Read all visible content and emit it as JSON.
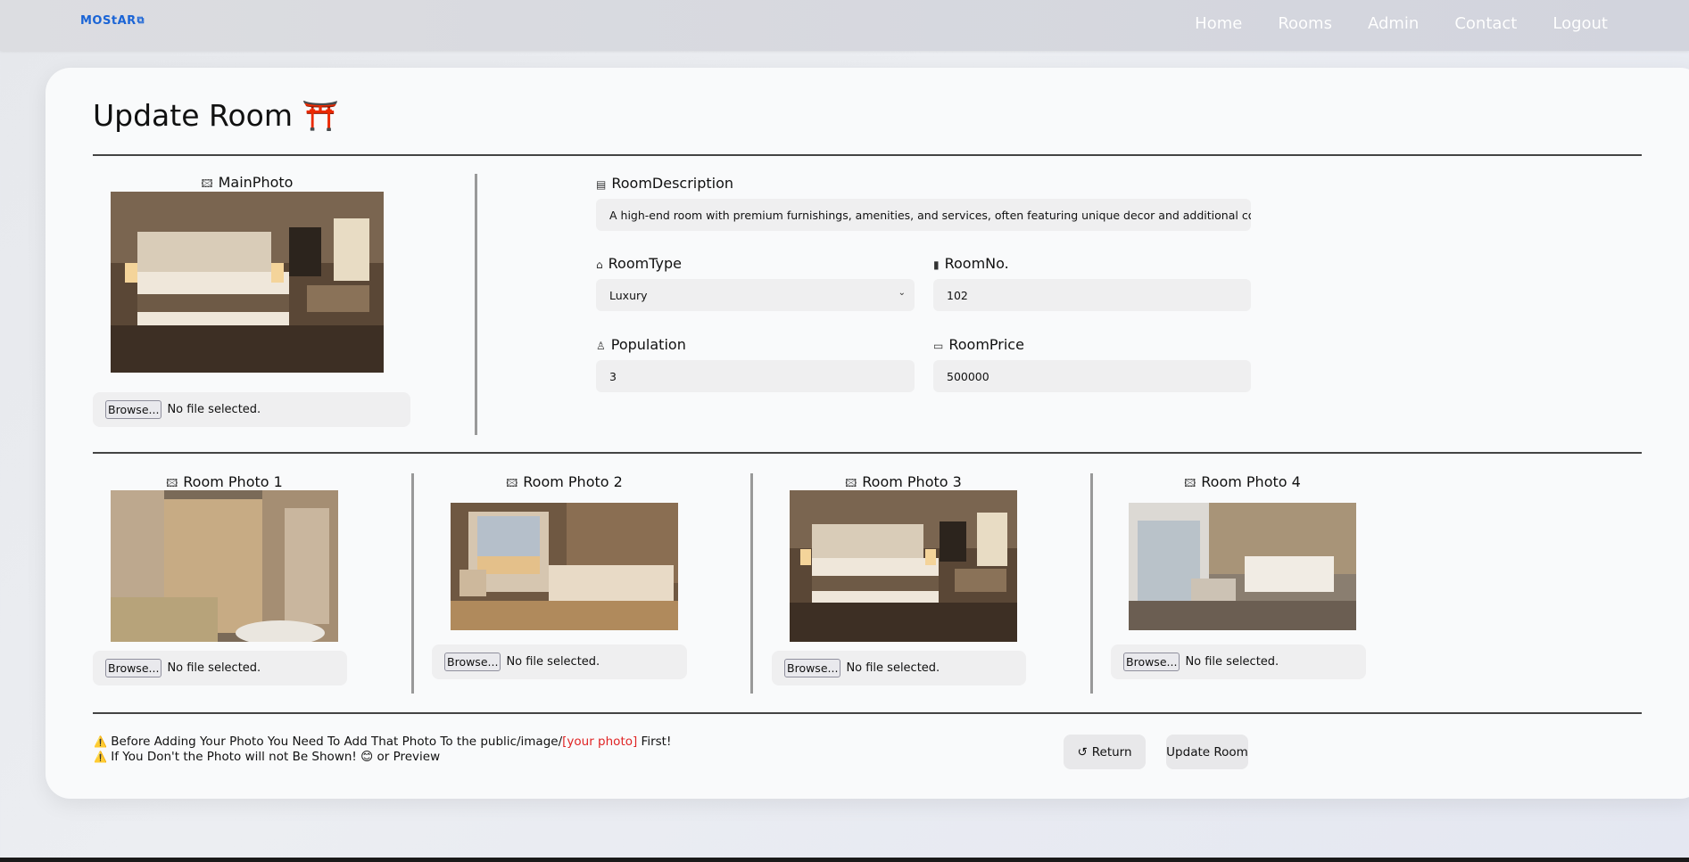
{
  "nav": {
    "brand": "MOStAR",
    "brand_icon": "external-link-icon",
    "links": [
      "Home",
      "Rooms",
      "Admin",
      "Contact",
      "Logout"
    ]
  },
  "page": {
    "title": "Update Room",
    "title_emoji": "⛩️"
  },
  "main_photo": {
    "label": "MainPhoto",
    "browse_label": "Browse...",
    "file_status": "No file selected."
  },
  "form": {
    "description": {
      "label": "RoomDescription",
      "value": "A high-end room with premium furnishings, amenities, and services, often featuring unique decor and additional comforts"
    },
    "room_type": {
      "label": "RoomType",
      "value": "Luxury"
    },
    "room_no": {
      "label": "RoomNo.",
      "value": "102"
    },
    "population": {
      "label": "Population",
      "value": "3"
    },
    "room_price": {
      "label": "RoomPrice",
      "value": "500000"
    }
  },
  "room_photos": [
    {
      "label": "Room Photo 1",
      "browse_label": "Browse...",
      "file_status": "No file selected."
    },
    {
      "label": "Room Photo 2",
      "browse_label": "Browse...",
      "file_status": "No file selected."
    },
    {
      "label": "Room Photo 3",
      "browse_label": "Browse...",
      "file_status": "No file selected."
    },
    {
      "label": "Room Photo 4",
      "browse_label": "Browse...",
      "file_status": "No file selected."
    }
  ],
  "notes": {
    "line1_prefix": "Before Adding Your Photo You Need To Add That Photo To the public/image/",
    "line1_highlight": "[your photo]",
    "line1_suffix": " First!",
    "line2_prefix": "If You Don't the Photo will not Be Shown!",
    "line2_emoji": "😊",
    "line2_suffix": " or Preview"
  },
  "buttons": {
    "return_label": "Return",
    "update_label": "Update Room"
  },
  "colors": {
    "brand": "#1a64d6",
    "highlight": "#e02424",
    "card": "#f9fafb"
  }
}
